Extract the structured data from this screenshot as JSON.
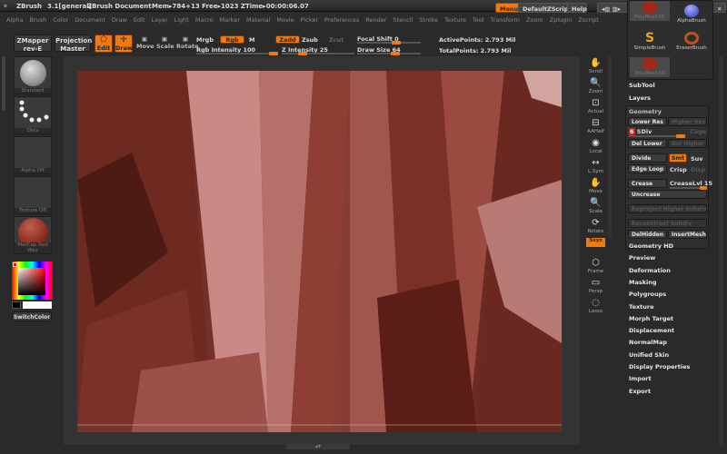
{
  "titlebar": {
    "app": "ZBrush",
    "version": "3.1[general]",
    "document": "ZBrush Document",
    "stats": "Mem▸784+13 Free▸1023 ZTime▸00:00:06.07",
    "menus": "Menus",
    "script": "DefaultZScript",
    "help": "Help"
  },
  "menus": [
    "Alpha",
    "Brush",
    "Color",
    "Document",
    "Draw",
    "Edit",
    "Layer",
    "Light",
    "Macro",
    "Marker",
    "Material",
    "Movie",
    "Picker",
    "Preferences",
    "Render",
    "Stencil",
    "Stroke",
    "Texture",
    "Tool",
    "Transform",
    "Zoom",
    "Zplugin",
    "Zscript"
  ],
  "toolbar": {
    "zmapper": "ZMapper",
    "zmapper_sub": "rev-E",
    "projection": "Projection",
    "projection_sub": "Master",
    "edit": "Edit",
    "draw": "Draw",
    "move": "Move",
    "scale": "Scale",
    "rotate": "Rotate",
    "mrgb": "Mrgb",
    "rgb": "Rgb",
    "m": "M",
    "rgb_intensity": "Rgb Intensity 100",
    "zadd": "Zadd",
    "zsub": "Zsub",
    "zcut": "Zcut",
    "z_intensity": "Z Intensity 25",
    "focal_shift": "Focal Shift 0",
    "draw_size": "Draw Size 64",
    "active_points": "ActivePoints: 2.793 Mil",
    "total_points": "TotalPoints: 2.793 Mil",
    "rgb_intensity_value": 100,
    "z_intensity_value": 25,
    "focal_shift_value": 0,
    "draw_size_value": 64
  },
  "left_shelf": {
    "brush": "Standard",
    "stroke": "Dots",
    "alpha": "Alpha Off",
    "texture": "Texture Off",
    "material": "MatCap Red Wax",
    "switch_color": "SwitchColor",
    "main_color": "#000000",
    "secondary_color": "#ffffff"
  },
  "right_shelf": [
    {
      "label": "Scroll",
      "icon": "hand"
    },
    {
      "label": "Zoom",
      "icon": "magnifier"
    },
    {
      "label": "Actual",
      "icon": "actual"
    },
    {
      "label": "AAHalf",
      "icon": "aahalf"
    },
    {
      "label": "Local",
      "icon": "local"
    },
    {
      "label": "L.Sym",
      "icon": "symmetry"
    },
    {
      "label": "Move",
      "icon": "hand"
    },
    {
      "label": "Scale",
      "icon": "magnifier"
    },
    {
      "label": "Rotate",
      "icon": "rotate"
    },
    {
      "label": "Sxyz",
      "icon": "axis"
    },
    {
      "label": "Frame",
      "icon": "cube"
    },
    {
      "label": "Persp",
      "icon": "persp"
    },
    {
      "label": "Lasso",
      "icon": "lasso"
    }
  ],
  "tool_palette": {
    "items": [
      "PolyMesh3D",
      "AlphaBrush",
      "SimpleBrush",
      "EraserBrush",
      "PolyMesh3D"
    ]
  },
  "right_panel": {
    "subtool": "SubTool",
    "layers": "Layers",
    "geometry": "Geometry",
    "geo": {
      "lower_res": "Lower Res",
      "higher_res": "Higher Res",
      "sdiv": "SDiv",
      "sdiv_value": 6,
      "cage": "Cage",
      "del_lower": "Del Lower",
      "del_higher": "Del Higher",
      "divide": "Divide",
      "smt": "Smt",
      "suv": "Suv",
      "edge_loop": "Edge Loop",
      "crisp": "Crisp",
      "disp": "Disp",
      "crease": "Crease",
      "crease_lvl": "CreaseLvl 15",
      "uncrease": "Uncrease",
      "reproject": "Reproject Higher Subdiv",
      "reconstruct": "Reconstruct Subdiv",
      "del_hidden": "DelHidden",
      "insert_mesh": "InsertMesh"
    },
    "sections": [
      "Geometry HD",
      "Preview",
      "Deformation",
      "Masking",
      "Polygroups",
      "Texture",
      "Morph Target",
      "Displacement",
      "NormalMap",
      "Unified Skin",
      "Display Properties",
      "Import",
      "Export"
    ]
  },
  "colors": {
    "accent": "#f07a10",
    "mesh": "#7a3328"
  }
}
